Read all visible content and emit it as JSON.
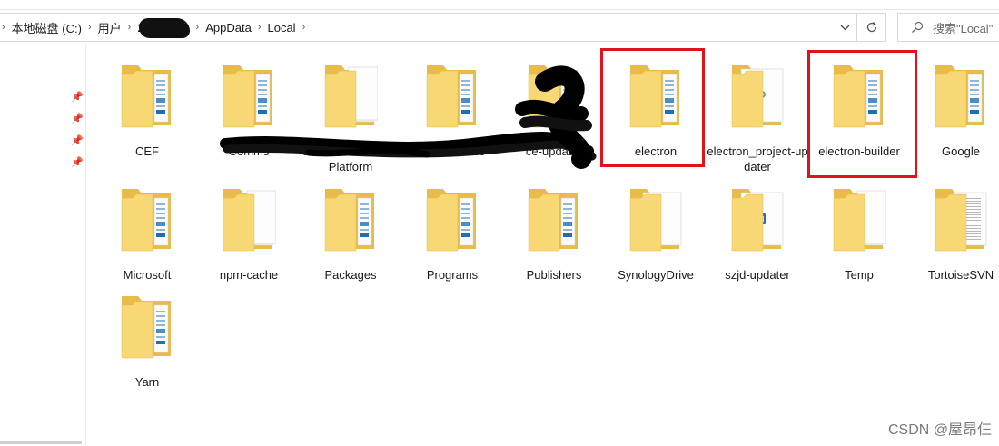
{
  "address_bar": {
    "crumbs": [
      "本地磁盘 (C:)",
      "用户",
      "",
      "AppData",
      "Local"
    ],
    "crumb_lead_char": "2"
  },
  "search": {
    "placeholder": "搜索\"Local\""
  },
  "items": [
    {
      "label": "CEF",
      "type": "folder-docs"
    },
    {
      "label": "Comms",
      "type": "folder-docs"
    },
    {
      "label": "ConnectedDevicesPlatform",
      "type": "folder-files"
    },
    {
      "label": "D3DSCache",
      "type": "folder-docs"
    },
    {
      "label": "ce-updater",
      "type": "folder-docs"
    },
    {
      "label": "electron",
      "type": "folder-docs"
    },
    {
      "label": "electron_project-updater",
      "type": "folder-file-logo"
    },
    {
      "label": "electron-builder",
      "type": "folder-docs"
    },
    {
      "label": "Google",
      "type": "folder-docs"
    },
    {
      "label": "Microsoft",
      "type": "folder-docs"
    },
    {
      "label": "npm-cache",
      "type": "folder-files"
    },
    {
      "label": "Packages",
      "type": "folder-docs"
    },
    {
      "label": "Programs",
      "type": "folder-docs"
    },
    {
      "label": "Publishers",
      "type": "folder-docs"
    },
    {
      "label": "SynologyDrive",
      "type": "folder-blank"
    },
    {
      "label": "szjd-updater",
      "type": "folder-file-logo2"
    },
    {
      "label": "Temp",
      "type": "folder-files"
    },
    {
      "label": "TortoiseSVN",
      "type": "folder-text"
    },
    {
      "label": "Yarn",
      "type": "folder-docs"
    }
  ],
  "watermark": "CSDN @屋昂仨",
  "colors": {
    "highlight": "#e0131b",
    "folder": "#f8d775"
  }
}
